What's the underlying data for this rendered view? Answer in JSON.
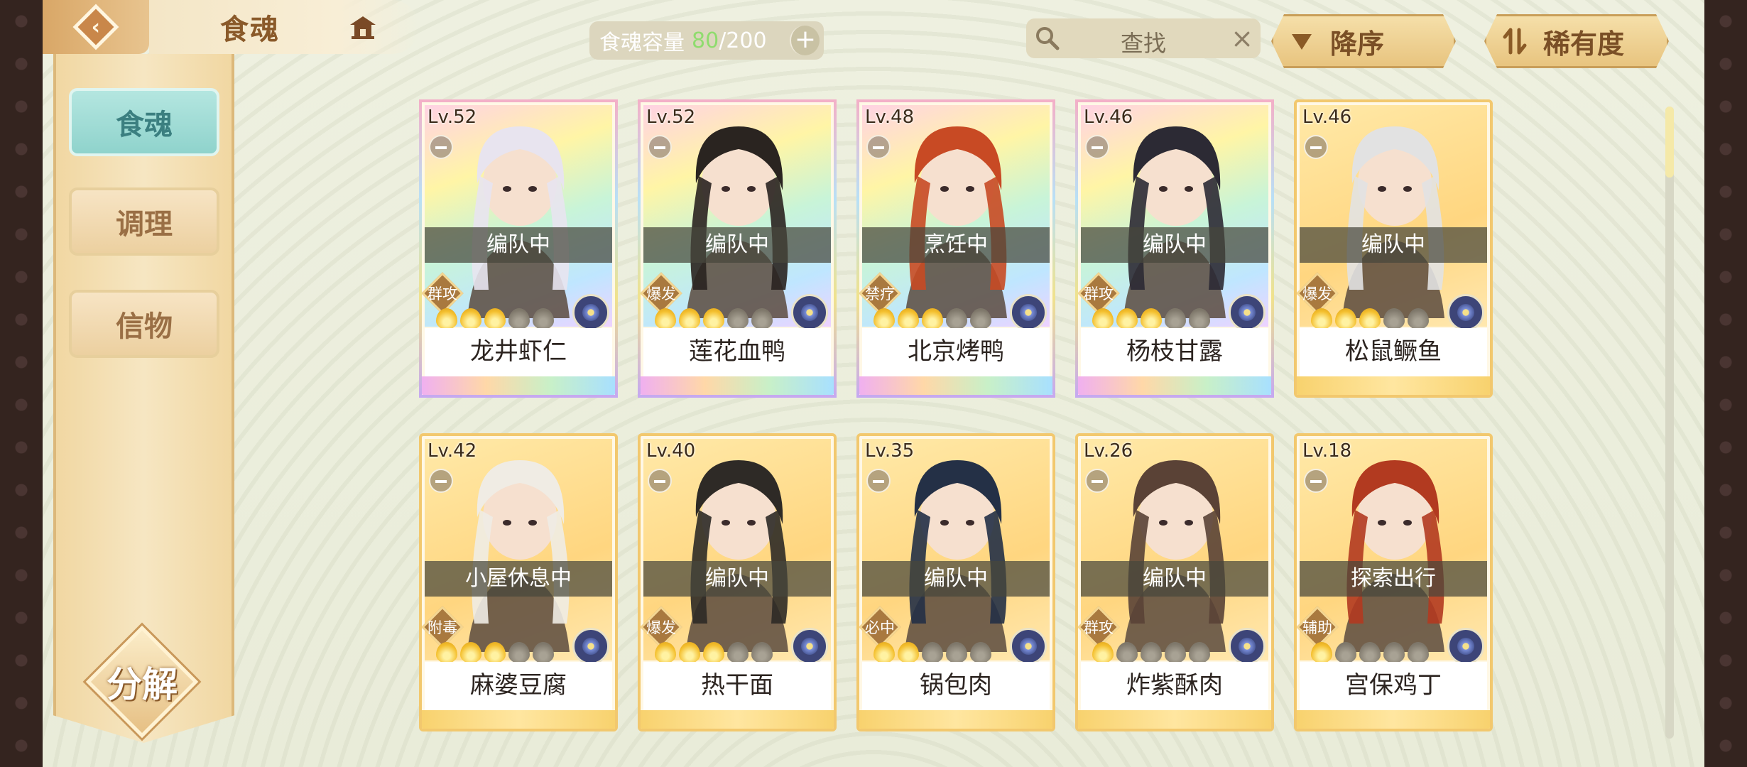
{
  "header": {
    "title": "食魂",
    "capacity_label": "食魂容量",
    "capacity_current": "80",
    "capacity_max": "/200",
    "search_placeholder": "查找",
    "sort_order_label": "降序",
    "sort_key_label": "稀有度"
  },
  "sidebar": {
    "items": [
      {
        "label": "食魂",
        "active": true
      },
      {
        "label": "调理",
        "active": false
      },
      {
        "label": "信物",
        "active": false
      }
    ],
    "decompose_label": "分解"
  },
  "cards": [
    {
      "level": "Lv.52",
      "status": "编队中",
      "role": "群攻",
      "stars": 3,
      "name": "龙井虾仁",
      "rarity": "rainbow"
    },
    {
      "level": "Lv.52",
      "status": "编队中",
      "role": "爆发",
      "stars": 3,
      "name": "莲花血鸭",
      "rarity": "rainbow"
    },
    {
      "level": "Lv.48",
      "status": "烹饪中",
      "role": "禁疗",
      "stars": 3,
      "name": "北京烤鸭",
      "rarity": "rainbow"
    },
    {
      "level": "Lv.46",
      "status": "编队中",
      "role": "群攻",
      "stars": 3,
      "name": "杨枝甘露",
      "rarity": "rainbow"
    },
    {
      "level": "Lv.46",
      "status": "编队中",
      "role": "爆发",
      "stars": 3,
      "name": "松鼠鳜鱼",
      "rarity": "gold"
    },
    {
      "level": "Lv.42",
      "status": "小屋休息中",
      "role": "附毒",
      "stars": 3,
      "name": "麻婆豆腐",
      "rarity": "gold"
    },
    {
      "level": "Lv.40",
      "status": "编队中",
      "role": "爆发",
      "stars": 3,
      "name": "热干面",
      "rarity": "gold"
    },
    {
      "level": "Lv.35",
      "status": "编队中",
      "role": "必中",
      "stars": 2,
      "name": "锅包肉",
      "rarity": "gold"
    },
    {
      "level": "Lv.26",
      "status": "编队中",
      "role": "群攻",
      "stars": 1,
      "name": "炸紫酥肉",
      "rarity": "gold"
    },
    {
      "level": "Lv.18",
      "status": "探索出行",
      "role": "辅助",
      "stars": 1,
      "name": "宫保鸡丁",
      "rarity": "gold"
    }
  ],
  "colors": {
    "accent_gold": "#e8c47f",
    "active_tab": "#8fd3cc",
    "capacity_current": "#8fdc6e"
  },
  "icons": [
    "back-icon",
    "home-icon",
    "plus-icon",
    "search-icon",
    "close-icon",
    "sort-desc-icon",
    "sort-rarity-icon",
    "lock-icon",
    "flavor-icon"
  ]
}
